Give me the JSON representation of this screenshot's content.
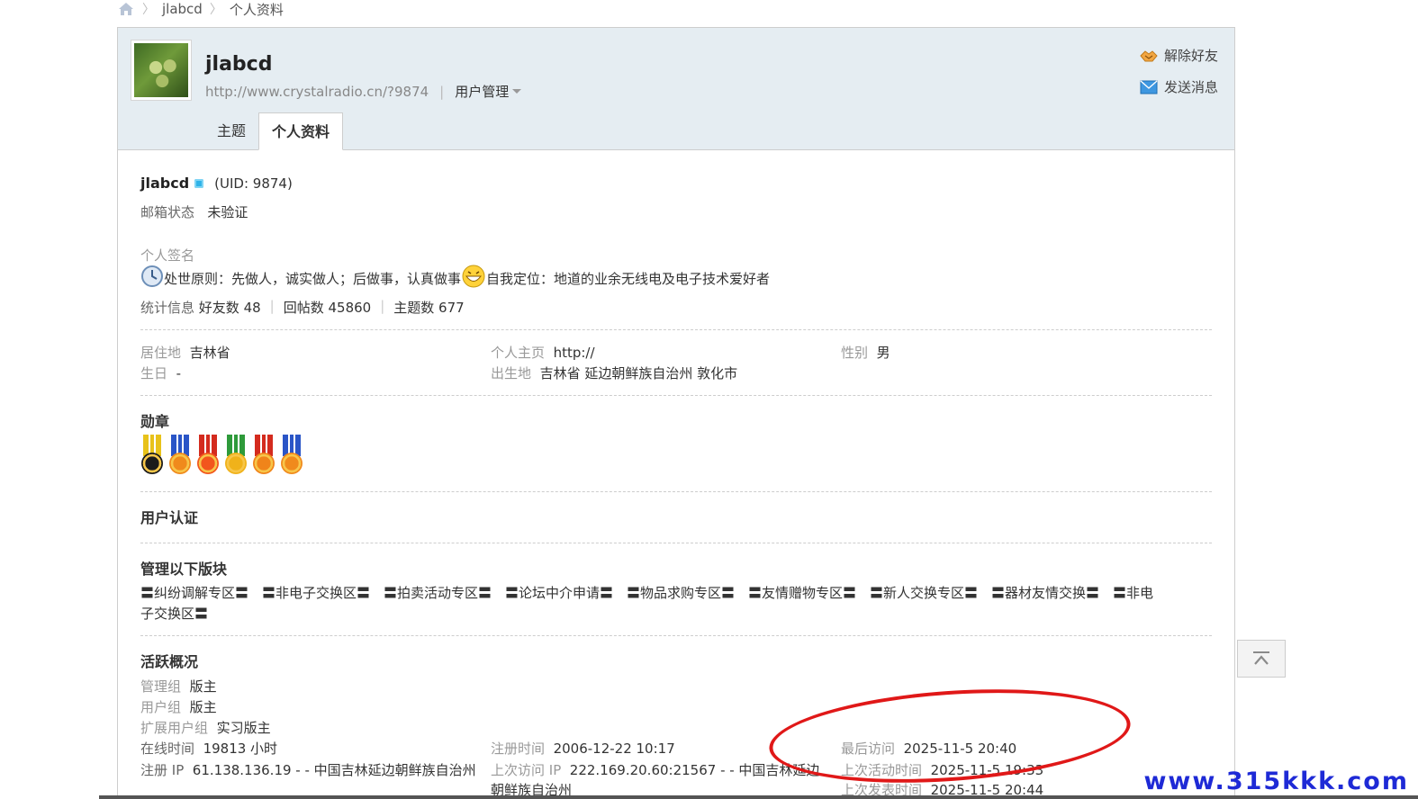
{
  "breadcrumb": {
    "user": "jlabcd",
    "page": "个人资料"
  },
  "header": {
    "username": "jlabcd",
    "url": "http://www.crystalradio.cn/?9874",
    "mgmt_label": "用户管理",
    "unfriend_label": "解除好友",
    "message_label": "发送消息",
    "tabs": [
      {
        "label": "主题"
      },
      {
        "label": "个人资料"
      }
    ]
  },
  "profile": {
    "name": "jlabcd",
    "uid": "(UID: 9874)",
    "email_label": "邮箱状态",
    "email_value": "未验证",
    "sig_label": "个人签名",
    "sig_part1": "处世原则：先做人，诚实做人；后做事，认真做事",
    "sig_part2": "自我定位：地道的业余无线电及电子技术爱好者",
    "stats_label": "统计信息",
    "friends": "好友数 48",
    "replies": "回帖数 45860",
    "topics": "主题数 677"
  },
  "info": {
    "residence_label": "居住地",
    "residence_value": "吉林省",
    "homepage_label": "个人主页",
    "homepage_value": "http://",
    "gender_label": "性别",
    "gender_value": "男",
    "birthday_label": "生日",
    "birthday_value": "-",
    "birthplace_label": "出生地",
    "birthplace_value": "吉林省 延边朝鲜族自治州 敦化市"
  },
  "medals": {
    "title": "勋章",
    "items": [
      {
        "ribbon": "#e8c21a",
        "disc": "#1b1b1b"
      },
      {
        "ribbon": "#2a55c7",
        "disc": "#f08a1c"
      },
      {
        "ribbon": "#d42b1e",
        "disc": "#f2561d"
      },
      {
        "ribbon": "#2e9a3a",
        "disc": "#f0b21a"
      },
      {
        "ribbon": "#d42b1e",
        "disc": "#f0841a"
      },
      {
        "ribbon": "#2a55c7",
        "disc": "#f08a1c"
      }
    ]
  },
  "verify": {
    "title": "用户认证"
  },
  "boards": {
    "title": "管理以下版块",
    "line1": "〓纠纷调解专区〓　〓非电子交换区〓　〓拍卖活动专区〓　〓论坛中介申请〓　〓物品求购专区〓　〓友情赠物专区〓　〓新人交换专区〓　〓器材友情交换〓　〓非电",
    "line2": "子交换区〓"
  },
  "activity": {
    "title": "活跃概况",
    "group_label": "管理组",
    "group_value": "版主",
    "usergroup_label": "用户组",
    "usergroup_value": "版主",
    "extgroup_label": "扩展用户组",
    "extgroup_value": "实习版主",
    "online_label": "在线时间",
    "online_value": "19813 小时",
    "reg_label": "注册时间",
    "reg_value": "2006-12-22 10:17",
    "last_visit_label": "最后访问",
    "last_visit_value": "2025-11-5 20:40",
    "reg_ip_label": "注册 IP",
    "reg_ip_value": "61.138.136.19 - - 中国吉林延边朝鲜族自治州",
    "last_ip_label": "上次访问 IP",
    "last_ip_value": "222.169.20.60:21567 - - 中国吉林延边",
    "last_ip_value2": "朝鲜族自治州",
    "last_active_label": "上次活动时间",
    "last_active_value": "2025-11-5 19:33",
    "last_post_label": "上次发表时间",
    "last_post_value": "2025-11-5 20:44"
  },
  "watermark": "www.315kkk.com"
}
